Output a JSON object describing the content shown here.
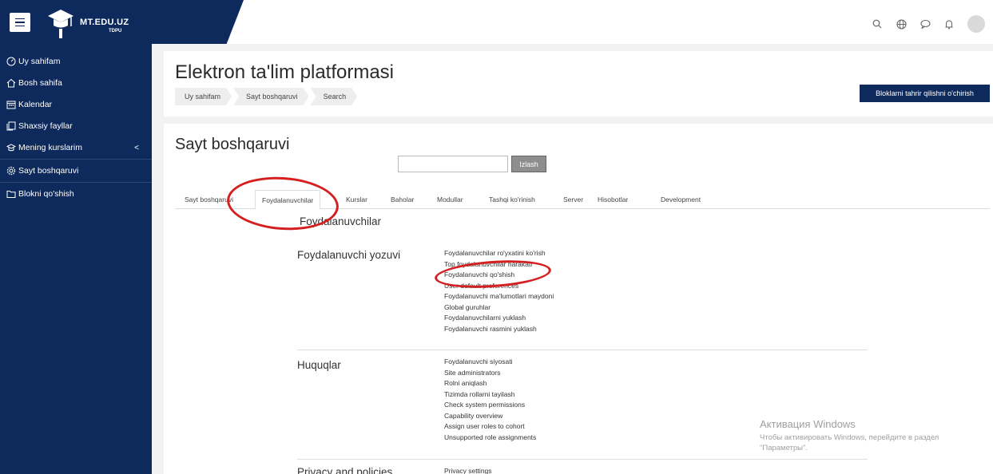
{
  "header": {
    "logo_text": "MT.EDU.UZ",
    "logo_sub": "TDPU",
    "icons": [
      "search-icon",
      "globe-icon",
      "chat-icon",
      "bell-icon",
      "avatar"
    ]
  },
  "sidebar": {
    "items": [
      {
        "label": "Uy sahifam",
        "icon": "dashboard-icon"
      },
      {
        "label": "Bosh sahifa",
        "icon": "home-icon"
      },
      {
        "label": "Kalendar",
        "icon": "calendar-icon"
      },
      {
        "label": "Shaxsiy fayllar",
        "icon": "files-icon"
      },
      {
        "label": "Mening kurslarim",
        "icon": "graduation-cap-icon",
        "chevron": "<"
      },
      {
        "label": "Sayt boshqaruvi",
        "icon": "gear-icon"
      },
      {
        "label": "Blokni qo'shish",
        "icon": "folder-icon"
      }
    ]
  },
  "page": {
    "title": "Elektron ta'lim platformasi",
    "breadcrumb": [
      "Uy sahifam",
      "Sayt boshqaruvi",
      "Search"
    ],
    "edit_button": "Bloklarni tahrir qilishni o'chirish"
  },
  "admin": {
    "title": "Sayt boshqaruvi",
    "search_value": "",
    "search_button": "Izlash",
    "tabs": [
      "Sayt boshqaruvi",
      "Foydalanuvchilar",
      "Kurslar",
      "Baholar",
      "Modullar",
      "Tashqi ko'rinish",
      "Server",
      "Hisobotlar",
      "Development"
    ],
    "active_tab": "Foydalanuvchilar",
    "category_title": "Foydalanuvchilar",
    "sections": [
      {
        "heading": "Foydalanuvchi yozuvi",
        "links": [
          "Foydalanuvchilar ro'yxatini ko'rish",
          "Top foydalanuvchilar harakati",
          "Foydalanuvchi qo'shish",
          "User default preferences",
          "Foydalanuvchi ma'lumotlari maydoni",
          "Global guruhlar",
          "Foydalanuvchilarni yuklash",
          "Foydalanuvchi rasmini yuklash"
        ]
      },
      {
        "heading": "Huquqlar",
        "links": [
          "Foydalanuvchi siyosati",
          "Site administrators",
          "Rolni aniqlash",
          "Tizimda rollarni tayilash",
          "Check system permissions",
          "Capability overview",
          "Assign user roles to cohort",
          "Unsupported role assignments"
        ]
      },
      {
        "heading": "Privacy and policies",
        "links": [
          "Privacy settings"
        ]
      }
    ]
  },
  "watermark": {
    "line1": "Активация Windows",
    "line2": "Чтобы активировать Windows, перейдите в раздел",
    "line3": "\"Параметры\"."
  },
  "colors": {
    "navy": "#0e2a5c",
    "annotation_red": "#d42020"
  }
}
